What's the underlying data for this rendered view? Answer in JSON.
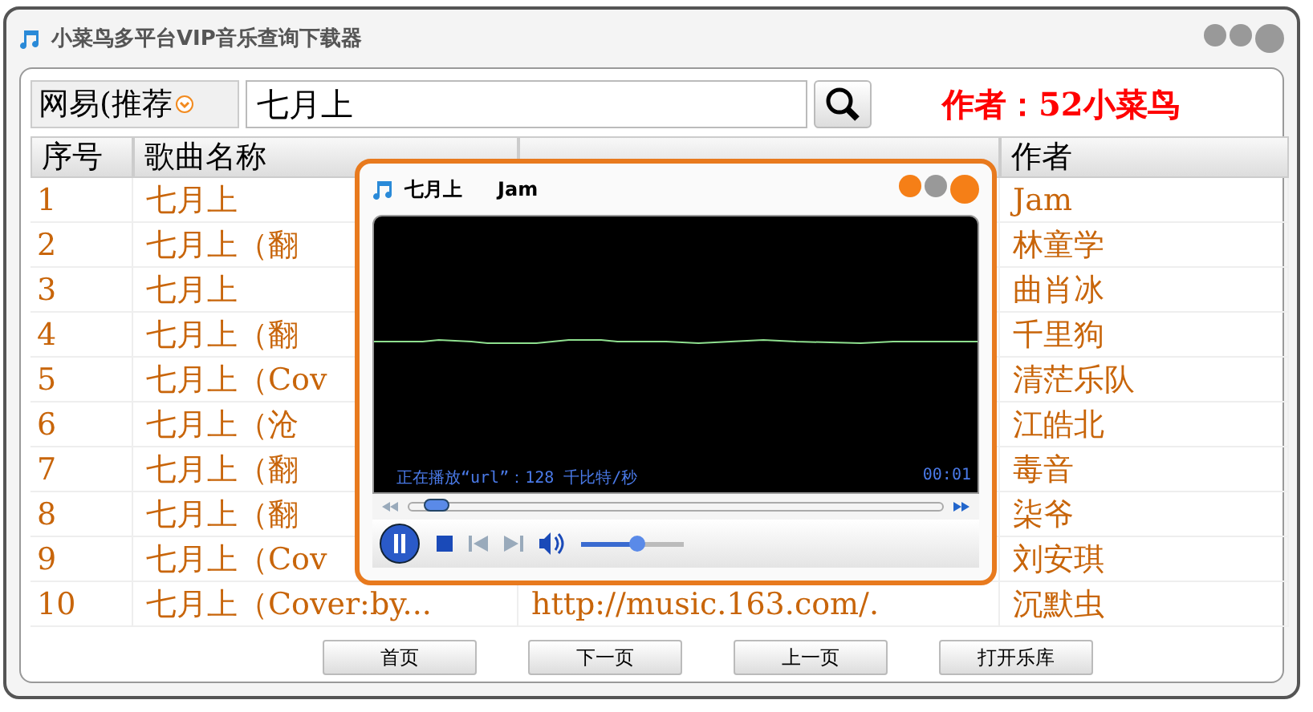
{
  "window": {
    "title": "小菜鸟多平台VIP音乐查询下载器"
  },
  "search": {
    "source": "网易(推荐",
    "value": "七月上",
    "author_note": "作者：52小菜鸟"
  },
  "table": {
    "columns": [
      "序号",
      "歌曲名称",
      "",
      "作者"
    ],
    "rows": [
      {
        "cells": [
          "1",
          "七月上",
          "",
          "Jam"
        ]
      },
      {
        "cells": [
          "2",
          "七月上（翻",
          "",
          "林童学"
        ]
      },
      {
        "cells": [
          "3",
          "七月上",
          "",
          "曲肖冰"
        ]
      },
      {
        "cells": [
          "4",
          "七月上（翻",
          "",
          "千里狗"
        ]
      },
      {
        "cells": [
          "5",
          "七月上（Cov",
          "",
          "清茫乐队"
        ]
      },
      {
        "cells": [
          "6",
          "七月上（沧",
          "",
          "江皓北"
        ]
      },
      {
        "cells": [
          "7",
          "七月上（翻",
          "",
          "毒音"
        ]
      },
      {
        "cells": [
          "8",
          "七月上（翻",
          "",
          "柒爷"
        ]
      },
      {
        "cells": [
          "9",
          "七月上（Cov",
          "",
          "刘安琪"
        ]
      },
      {
        "cells": [
          "10",
          "七月上（Cover:by...",
          "http://music.163.com/.",
          "沉默虫"
        ]
      }
    ]
  },
  "buttons": [
    "首页",
    "下一页",
    "上一页",
    "打开乐库"
  ],
  "player": {
    "title": "七月上",
    "artist": "Jam",
    "status": "正在播放“url”：128 千比特/秒",
    "time": "00:01",
    "playing": true,
    "seek": {
      "level": 0.03
    },
    "volume": {
      "level": 0.55
    }
  }
}
